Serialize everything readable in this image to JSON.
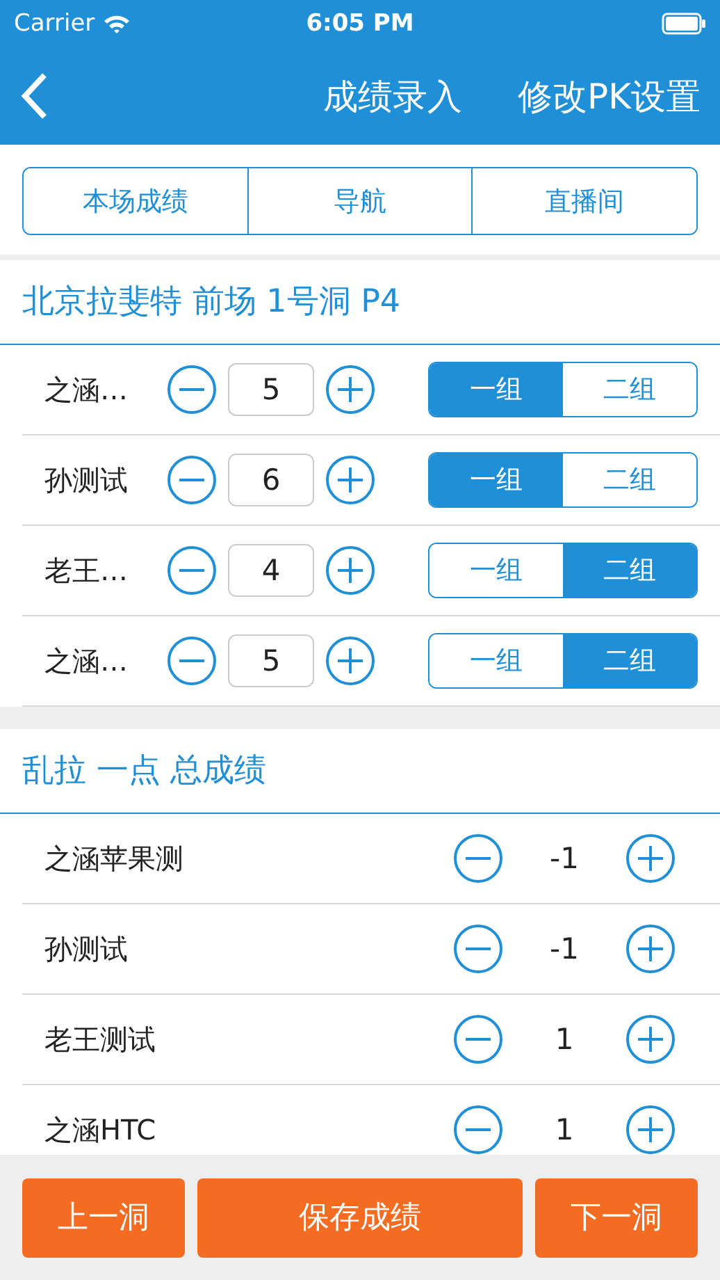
{
  "status_bar": {
    "carrier": "Carrier",
    "time": "6:05 PM"
  },
  "nav_bar": {
    "title": "成绩录入",
    "action": "修改PK设置"
  },
  "tabs": [
    {
      "label": "本场成绩"
    },
    {
      "label": "导航"
    },
    {
      "label": "直播间"
    }
  ],
  "hole": {
    "title": "北京拉斐特 前场 1号洞 P4",
    "players": [
      {
        "name": "之涵…",
        "strokes": "5",
        "groups": [
          {
            "label": "一组",
            "selected": true
          },
          {
            "label": "二组",
            "selected": false
          }
        ]
      },
      {
        "name": "孙测试",
        "strokes": "6",
        "groups": [
          {
            "label": "一组",
            "selected": true
          },
          {
            "label": "二组",
            "selected": false
          }
        ]
      },
      {
        "name": "老王…",
        "strokes": "4",
        "groups": [
          {
            "label": "一组",
            "selected": false
          },
          {
            "label": "二组",
            "selected": true
          }
        ]
      },
      {
        "name": "之涵…",
        "strokes": "5",
        "groups": [
          {
            "label": "一组",
            "selected": false
          },
          {
            "label": "二组",
            "selected": true
          }
        ]
      }
    ]
  },
  "total": {
    "title": "乱拉 一点 总成绩",
    "players": [
      {
        "name": "之涵苹果测",
        "score": "-1"
      },
      {
        "name": "孙测试",
        "score": "-1"
      },
      {
        "name": "老王测试",
        "score": "1"
      },
      {
        "name": "之涵HTC",
        "score": "1"
      }
    ]
  },
  "bottom_bar": [
    "上一洞",
    "保存成绩",
    "下一洞"
  ]
}
